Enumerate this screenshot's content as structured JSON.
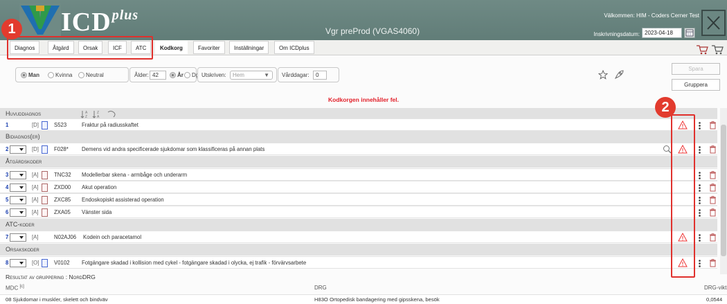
{
  "header": {
    "brand_main": "ICD",
    "brand_plus": "plus",
    "env_title": "Vgr preProd (VGAS4060)",
    "welcome": "Välkommen: HIM - Coders Cerner Test",
    "date_label": "Inskrivningsdatum:",
    "date_value": "2023-04-18"
  },
  "tabs": [
    "Diagnos",
    "Åtgärd",
    "Orsak",
    "ICF",
    "ATC",
    "Kodkorg",
    "Favoriter",
    "Inställningar",
    "Om ICDplus"
  ],
  "active_tab": "Kodkorg",
  "callouts": {
    "one": "1",
    "two": "2"
  },
  "patient": {
    "sex_options": [
      "Man",
      "Kvinna",
      "Neutral"
    ],
    "sex_selected": "Man",
    "age_label": "Ålder:",
    "age_value": "42",
    "age_units": [
      "År",
      "Dgr"
    ],
    "age_unit_selected": "År",
    "discharge_label": "Utskriven:",
    "discharge_value": "Hem",
    "care_days_label": "Vårddagar:",
    "care_days_value": "0"
  },
  "buttons": {
    "save": "Spara",
    "group": "Gruppera"
  },
  "error_message": "Kodkorgen innehåller fel.",
  "sections": {
    "main_diag": "Huvuddiagnos",
    "sec_diag": "Bidiagnos(er)",
    "procedures": "Åtgärdskoder",
    "atc": "ATC-koder",
    "causes": "Orsakskoder"
  },
  "rows": [
    {
      "num": "1",
      "tag": "[D]",
      "code": "S523",
      "desc": "Fraktur på radiusskaftet"
    },
    {
      "num": "2",
      "tag": "[D]",
      "code": "F028*",
      "desc": "Demens vid andra specificerade sjukdomar som klassificeras på annan plats"
    },
    {
      "num": "3",
      "tag": "[A]",
      "code": "TNC32",
      "desc": "Modellerbar skena - armbåge och underarm"
    },
    {
      "num": "4",
      "tag": "[A]",
      "code": "ZXD00",
      "desc": "Akut operation"
    },
    {
      "num": "5",
      "tag": "[A]",
      "code": "ZXC85",
      "desc": "Endoskopiskt assisterad operation"
    },
    {
      "num": "6",
      "tag": "[A]",
      "code": "ZXA05",
      "desc": "Vänster sida"
    },
    {
      "num": "7",
      "tag": "[A]",
      "code": "N02AJ06",
      "desc": "Kodein och paracetamol"
    },
    {
      "num": "8",
      "tag": "[O]",
      "code": "V0102",
      "desc": "Fotgängare skadad i kollision med cykel - fotgängare skadad i olycka, ej trafik - förvärvsarbete"
    }
  ],
  "result": {
    "title": "Resultat av gruppering : NordDRG",
    "mdc_label": "MDC",
    "mdc_sup": "[c]",
    "drg_label": "DRG",
    "weight_label": "DRG-vikt",
    "mdc_value": "08 Sjukdomar i muskler, skelett och bindväv",
    "drg_value": "H83O Ortopedisk bandagering med gipsskena, besök",
    "weight_value": "0,0544"
  }
}
